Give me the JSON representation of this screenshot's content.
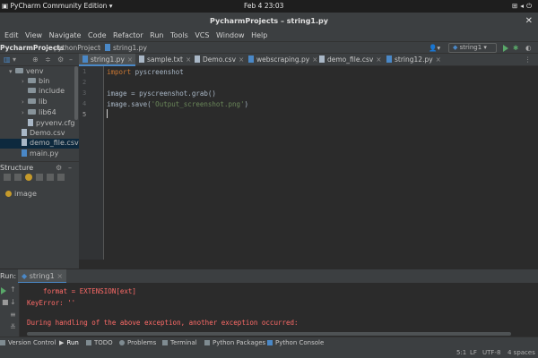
{
  "system": {
    "app_name": "PyCharm Community Edition",
    "clock": "Feb 4  23:03"
  },
  "window": {
    "title": "PycharmProjects – string1.py"
  },
  "menu": [
    "Edit",
    "View",
    "Navigate",
    "Code",
    "Refactor",
    "Run",
    "Tools",
    "VCS",
    "Window",
    "Help"
  ],
  "breadcrumb": [
    "PycharmProjects",
    "pythonProject",
    "string1.py"
  ],
  "run_config": "string1",
  "tabs": [
    {
      "label": "string1.py",
      "active": true
    },
    {
      "label": "sample.txt",
      "active": false
    },
    {
      "label": "Demo.csv",
      "active": false
    },
    {
      "label": "webscraping.py",
      "active": false
    },
    {
      "label": "demo_file.csv",
      "active": false
    },
    {
      "label": "string12.py",
      "active": false
    }
  ],
  "project_tree": [
    {
      "label": "venv",
      "type": "folder"
    },
    {
      "label": "bin",
      "type": "folder"
    },
    {
      "label": "include",
      "type": "folder"
    },
    {
      "label": "lib",
      "type": "folder"
    },
    {
      "label": "lib64",
      "type": "folder"
    },
    {
      "label": "pyvenv.cfg",
      "type": "file"
    },
    {
      "label": "Demo.csv",
      "type": "file"
    },
    {
      "label": "demo_file.csv",
      "type": "file"
    },
    {
      "label": "main.py",
      "type": "file"
    }
  ],
  "structure": {
    "title": "Structure",
    "items": [
      "image"
    ]
  },
  "editor": {
    "line_numbers": [
      "1",
      "2",
      "3",
      "4",
      "5"
    ],
    "lines": {
      "l1_keyword": "import",
      "l1_rest": " pyscreenshot",
      "l3": "image = pyscreenshot.grab()",
      "l4_start": "image.save(",
      "l4_string": "'Output_screenshot.png'",
      "l4_end": ")"
    }
  },
  "run_panel": {
    "label": "Run:",
    "config": "string1",
    "lines": [
      "    format = EXTENSION[ext]",
      "KeyError: ''",
      "",
      "During handling of the above exception, another exception occurred:"
    ]
  },
  "tool_windows": [
    "Version Control",
    "Run",
    "TODO",
    "Problems",
    "Terminal",
    "Python Packages",
    "Python Console"
  ],
  "status": {
    "position": "5:1",
    "line_sep": "LF",
    "encoding": "UTF-8",
    "indent": "4 spaces"
  },
  "colors": {
    "accent": "#4a88c7",
    "run_green": "#59a869",
    "error_red": "#ff6b68",
    "keyword": "#cc7832",
    "string": "#6a8759"
  }
}
